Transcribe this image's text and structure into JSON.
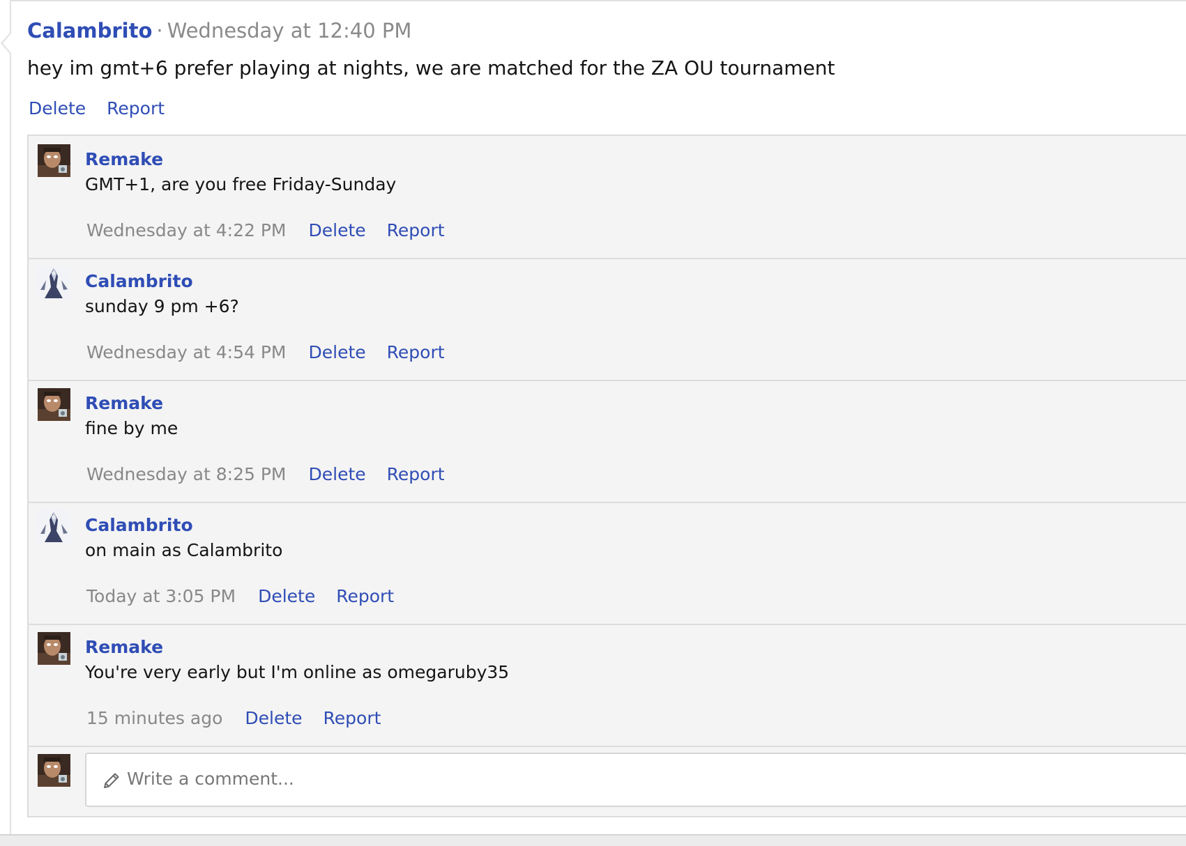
{
  "post": {
    "author": "Calambrito",
    "separator": "·",
    "time": "Wednesday at 12:40 PM",
    "text": "hey im gmt+6 prefer playing at nights, we are matched for the ZA OU tournament",
    "actions": {
      "delete": "Delete",
      "report": "Report"
    }
  },
  "comments": [
    {
      "author": "Remake",
      "avatar": "remake-avatar",
      "text": "GMT+1, are you free Friday-Sunday",
      "time": "Wednesday at 4:22 PM",
      "delete": "Delete",
      "report": "Report"
    },
    {
      "author": "Calambrito",
      "avatar": "calambrito-avatar",
      "text": "sunday 9 pm +6?",
      "time": "Wednesday at 4:54 PM",
      "delete": "Delete",
      "report": "Report"
    },
    {
      "author": "Remake",
      "avatar": "remake-avatar",
      "text": "fine by me",
      "time": "Wednesday at 8:25 PM",
      "delete": "Delete",
      "report": "Report"
    },
    {
      "author": "Calambrito",
      "avatar": "calambrito-avatar",
      "text": "on main as Calambrito",
      "time": "Today at 3:05 PM",
      "delete": "Delete",
      "report": "Report"
    },
    {
      "author": "Remake",
      "avatar": "remake-avatar",
      "text": "You're very early but I'm online as omegaruby35",
      "time": "15 minutes ago",
      "delete": "Delete",
      "report": "Report"
    }
  ],
  "composer": {
    "placeholder": "Write a comment...",
    "icon": "pencil-icon"
  },
  "colors": {
    "link": "#2f4db5",
    "muted": "#888888",
    "comment_background": "#f4f4f4",
    "border": "#dcdcdc"
  }
}
